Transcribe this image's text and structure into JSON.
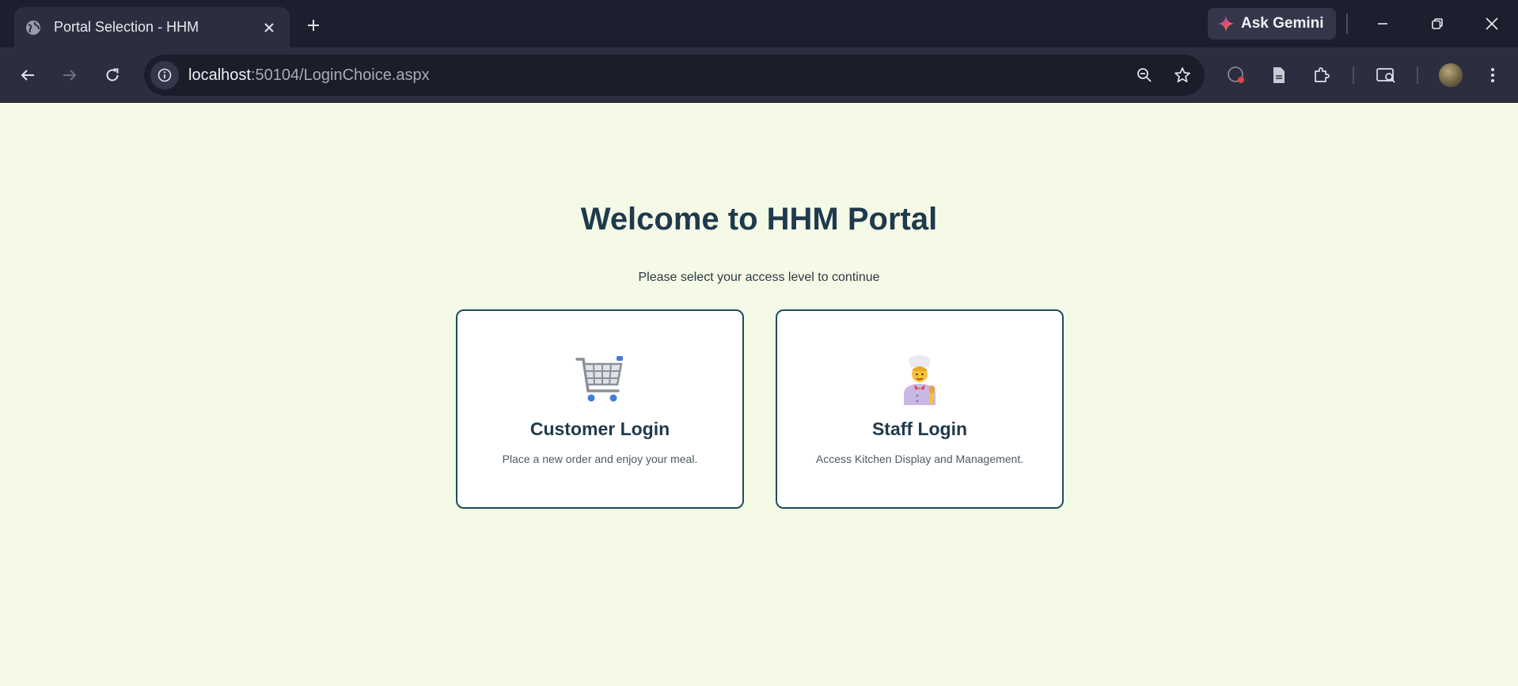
{
  "browser": {
    "tab_title": "Portal Selection - HHM",
    "gemini_label": "Ask Gemini",
    "url_host": "localhost",
    "url_rest": ":50104/LoginChoice.aspx",
    "icons": {
      "favicon": "globe-icon",
      "close_tab": "close-icon",
      "new_tab": "plus-icon",
      "back": "back-arrow-icon",
      "forward": "forward-arrow-icon",
      "reload": "reload-icon",
      "site_info": "info-icon",
      "zoom": "zoom-out-icon",
      "bookmark": "star-icon"
    }
  },
  "page": {
    "title": "Welcome to HHM Portal",
    "subtitle": "Please select your access level to continue",
    "cards": [
      {
        "title": "Customer Login",
        "description": "Place a new order and enjoy your meal.",
        "icon": "shopping-cart-icon"
      },
      {
        "title": "Staff Login",
        "description": "Access Kitchen Display and Management.",
        "icon": "chef-icon"
      }
    ]
  },
  "colors": {
    "page_background": "#f5fae7",
    "heading": "#1e3a4c",
    "card_border": "#1c4f59",
    "chrome_dark": "#1e1f2e",
    "chrome_toolbar": "#2c2e40"
  }
}
